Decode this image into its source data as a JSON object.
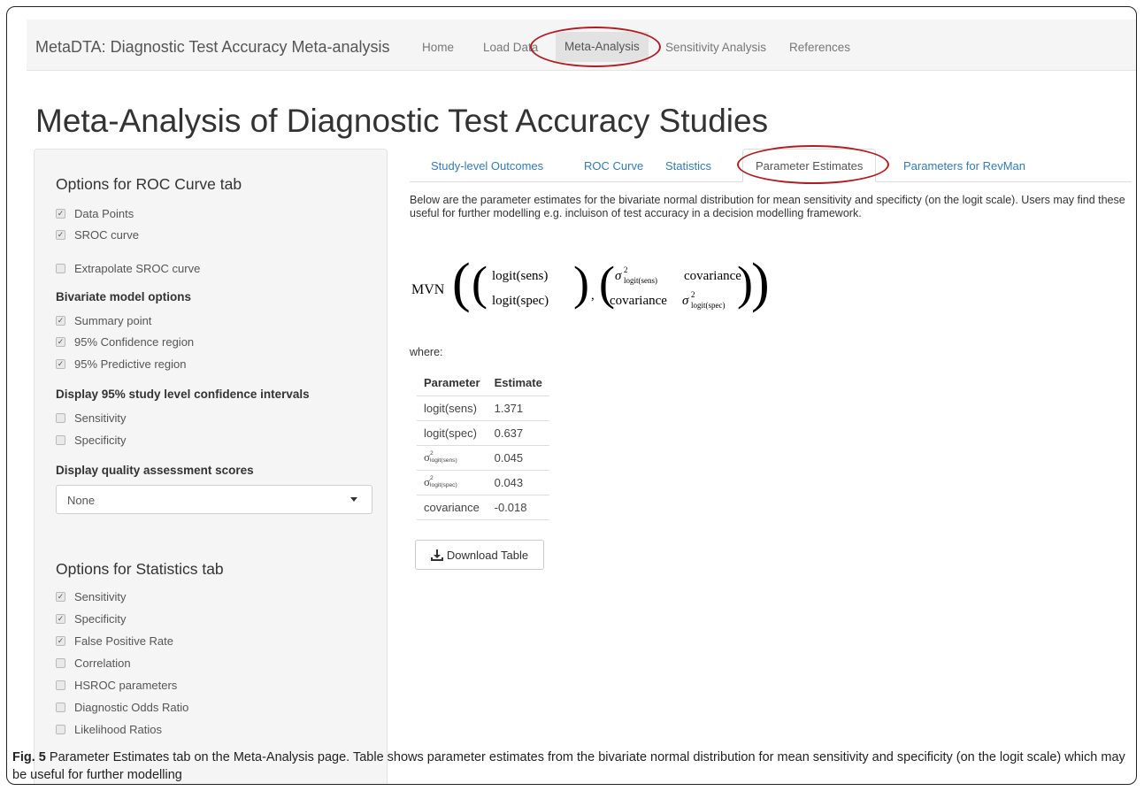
{
  "navbar": {
    "brand": "MetaDTA: Diagnostic Test Accuracy Meta-analysis",
    "items": [
      "Home",
      "Load Data",
      "Meta-Analysis",
      "Sensitivity Analysis",
      "References"
    ],
    "active": "Meta-Analysis"
  },
  "page_title": "Meta-Analysis of Diagnostic Test Accuracy Studies",
  "sidebar": {
    "roc_heading": "Options for ROC Curve tab",
    "roc_options": [
      {
        "label": "Data Points",
        "checked": true
      },
      {
        "label": "SROC curve",
        "checked": true
      },
      {
        "label": "Extrapolate SROC curve",
        "checked": false
      }
    ],
    "bivariate_heading": "Bivariate model options",
    "bivariate_options": [
      {
        "label": "Summary point",
        "checked": true
      },
      {
        "label": "95% Confidence region",
        "checked": true
      },
      {
        "label": "95% Predictive region",
        "checked": true
      }
    ],
    "ci_heading": "Display 95% study level confidence intervals",
    "ci_options": [
      {
        "label": "Sensitivity",
        "checked": false
      },
      {
        "label": "Specificity",
        "checked": false
      }
    ],
    "quality_heading": "Display quality assessment scores",
    "quality_select_value": "None",
    "stats_heading": "Options for Statistics tab",
    "stats_options": [
      {
        "label": "Sensitivity",
        "checked": true
      },
      {
        "label": "Specificity",
        "checked": true
      },
      {
        "label": "False Positive Rate",
        "checked": true
      },
      {
        "label": "Correlation",
        "checked": false
      },
      {
        "label": "HSROC parameters",
        "checked": false
      },
      {
        "label": "Diagnostic Odds Ratio",
        "checked": false
      },
      {
        "label": "Likelihood Ratios",
        "checked": false
      }
    ]
  },
  "tabs": [
    "Study-level Outcomes",
    "ROC Curve",
    "Statistics",
    "Parameter Estimates",
    "Parameters for RevMan"
  ],
  "active_tab": "Parameter Estimates",
  "description": "Below are the parameter estimates for the bivariate normal distribution for mean sensitivity and specificty (on the logit scale). Users may find these useful for further modelling e.g. incluison of test accuracy in a decision modelling framework.",
  "formula": {
    "mvn": "MVN",
    "mean_top": "logit(sens)",
    "mean_bottom": "logit(spec)",
    "cov_label": "covariance",
    "sigma": "σ",
    "sq": "2",
    "sub_sens": "logit(sens)",
    "sub_spec": "logit(spec)"
  },
  "where_label": "where:",
  "table": {
    "headers": [
      "Parameter",
      "Estimate"
    ],
    "rows": [
      {
        "param": "logit(sens)",
        "value": "1.371"
      },
      {
        "param": "logit(spec)",
        "value": "0.637"
      },
      {
        "param": "σ",
        "sub": "logit(sens)",
        "sup": "2",
        "value": "0.045"
      },
      {
        "param": "σ",
        "sub": "logit(spec)",
        "sup": "2",
        "value": "0.043"
      },
      {
        "param": "covariance",
        "value": "-0.018"
      }
    ]
  },
  "download_button": "Download Table",
  "caption": {
    "label": "Fig. 5",
    "text": " Parameter Estimates tab on the Meta-Analysis page. Table shows parameter estimates from the bivariate normal distribution for mean sensitivity and specificity (on the logit scale) which may be useful for further modelling"
  },
  "colors": {
    "highlight_ring": "#b01e24",
    "link": "#337ab7"
  }
}
